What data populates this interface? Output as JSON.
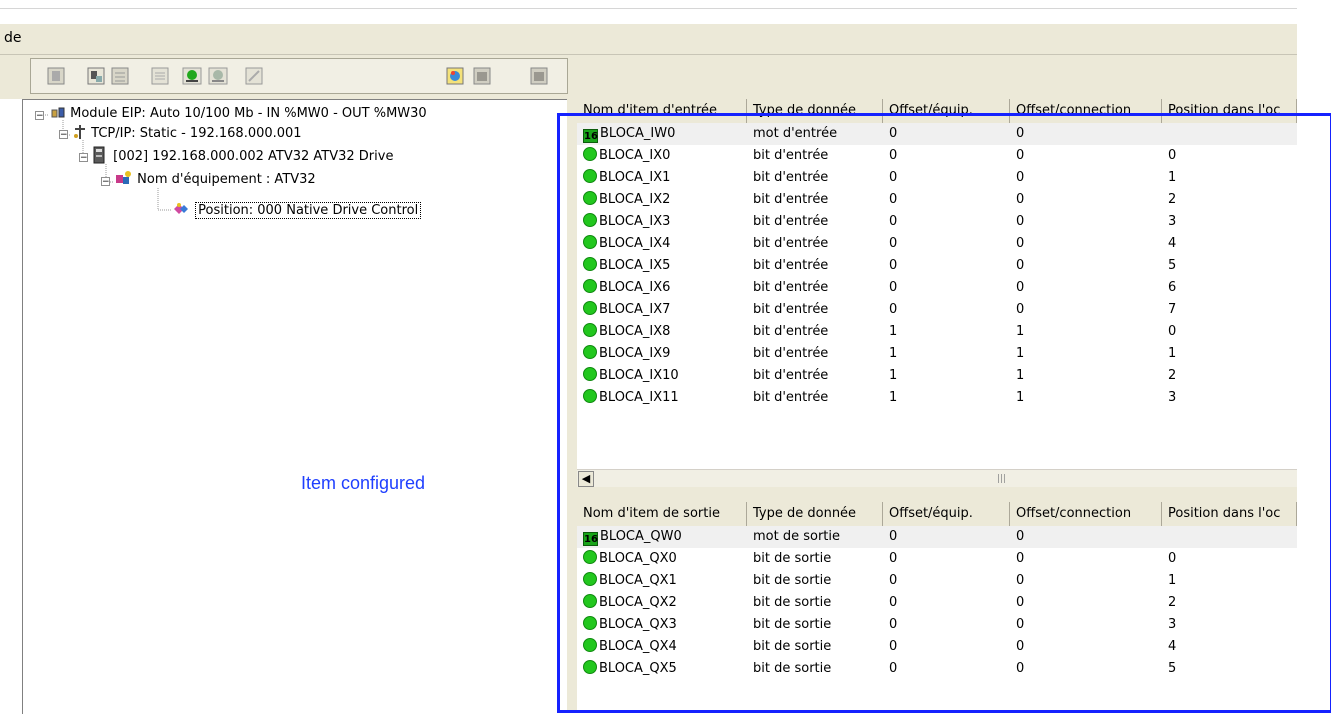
{
  "menubar": {
    "label": "de"
  },
  "toolbar": {
    "icons": [
      "delete-icon",
      "device-icon",
      "properties-icon",
      "list-icon",
      "connect-icon",
      "disconnect-icon",
      "wizard-icon",
      "import-icon",
      "export-icon",
      "save-icon"
    ]
  },
  "tree": {
    "module": "Module EIP: Auto 10/100 Mb - IN %MW0 - OUT %MW30",
    "tcp": "TCP/IP: Static - 192.168.000.001",
    "device": "[002] 192.168.000.002  ATV32  ATV32 Drive",
    "equipment": "Nom d'équipement : ATV32",
    "position": "Position: 000  Native Drive Control"
  },
  "annotation": "Item configured",
  "input_table": {
    "headers": [
      "Nom d'item d'entrée",
      "Type de donnée",
      "Offset/équip.",
      "Offset/connection",
      "Position dans l'oc"
    ],
    "rows": [
      {
        "icon": "word",
        "name": "BLOCA_IW0",
        "type": "mot d'entrée",
        "off_equip": "0",
        "off_conn": "0",
        "pos": ""
      },
      {
        "icon": "bit",
        "name": "BLOCA_IX0",
        "type": "bit d'entrée",
        "off_equip": "0",
        "off_conn": "0",
        "pos": "0"
      },
      {
        "icon": "bit",
        "name": "BLOCA_IX1",
        "type": "bit d'entrée",
        "off_equip": "0",
        "off_conn": "0",
        "pos": "1"
      },
      {
        "icon": "bit",
        "name": "BLOCA_IX2",
        "type": "bit d'entrée",
        "off_equip": "0",
        "off_conn": "0",
        "pos": "2"
      },
      {
        "icon": "bit",
        "name": "BLOCA_IX3",
        "type": "bit d'entrée",
        "off_equip": "0",
        "off_conn": "0",
        "pos": "3"
      },
      {
        "icon": "bit",
        "name": "BLOCA_IX4",
        "type": "bit d'entrée",
        "off_equip": "0",
        "off_conn": "0",
        "pos": "4"
      },
      {
        "icon": "bit",
        "name": "BLOCA_IX5",
        "type": "bit d'entrée",
        "off_equip": "0",
        "off_conn": "0",
        "pos": "5"
      },
      {
        "icon": "bit",
        "name": "BLOCA_IX6",
        "type": "bit d'entrée",
        "off_equip": "0",
        "off_conn": "0",
        "pos": "6"
      },
      {
        "icon": "bit",
        "name": "BLOCA_IX7",
        "type": "bit d'entrée",
        "off_equip": "0",
        "off_conn": "0",
        "pos": "7"
      },
      {
        "icon": "bit",
        "name": "BLOCA_IX8",
        "type": "bit d'entrée",
        "off_equip": "1",
        "off_conn": "1",
        "pos": "0"
      },
      {
        "icon": "bit",
        "name": "BLOCA_IX9",
        "type": "bit d'entrée",
        "off_equip": "1",
        "off_conn": "1",
        "pos": "1"
      },
      {
        "icon": "bit",
        "name": "BLOCA_IX10",
        "type": "bit d'entrée",
        "off_equip": "1",
        "off_conn": "1",
        "pos": "2"
      },
      {
        "icon": "bit",
        "name": "BLOCA_IX11",
        "type": "bit d'entrée",
        "off_equip": "1",
        "off_conn": "1",
        "pos": "3"
      }
    ]
  },
  "output_table": {
    "headers": [
      "Nom d'item de sortie",
      "Type de donnée",
      "Offset/équip.",
      "Offset/connection",
      "Position dans l'oc"
    ],
    "rows": [
      {
        "icon": "word",
        "name": "BLOCA_QW0",
        "type": "mot de sortie",
        "off_equip": "0",
        "off_conn": "0",
        "pos": ""
      },
      {
        "icon": "bit",
        "name": "BLOCA_QX0",
        "type": "bit de sortie",
        "off_equip": "0",
        "off_conn": "0",
        "pos": "0"
      },
      {
        "icon": "bit",
        "name": "BLOCA_QX1",
        "type": "bit de sortie",
        "off_equip": "0",
        "off_conn": "0",
        "pos": "1"
      },
      {
        "icon": "bit",
        "name": "BLOCA_QX2",
        "type": "bit de sortie",
        "off_equip": "0",
        "off_conn": "0",
        "pos": "2"
      },
      {
        "icon": "bit",
        "name": "BLOCA_QX3",
        "type": "bit de sortie",
        "off_equip": "0",
        "off_conn": "0",
        "pos": "3"
      },
      {
        "icon": "bit",
        "name": "BLOCA_QX4",
        "type": "bit de sortie",
        "off_equip": "0",
        "off_conn": "0",
        "pos": "4"
      },
      {
        "icon": "bit",
        "name": "BLOCA_QX5",
        "type": "bit de sortie",
        "off_equip": "0",
        "off_conn": "0",
        "pos": "5"
      }
    ]
  },
  "word_badge": "16",
  "colors": {
    "highlight": "#1522ff",
    "bit_green": "#22c71e",
    "panel": "#ece9d8"
  }
}
